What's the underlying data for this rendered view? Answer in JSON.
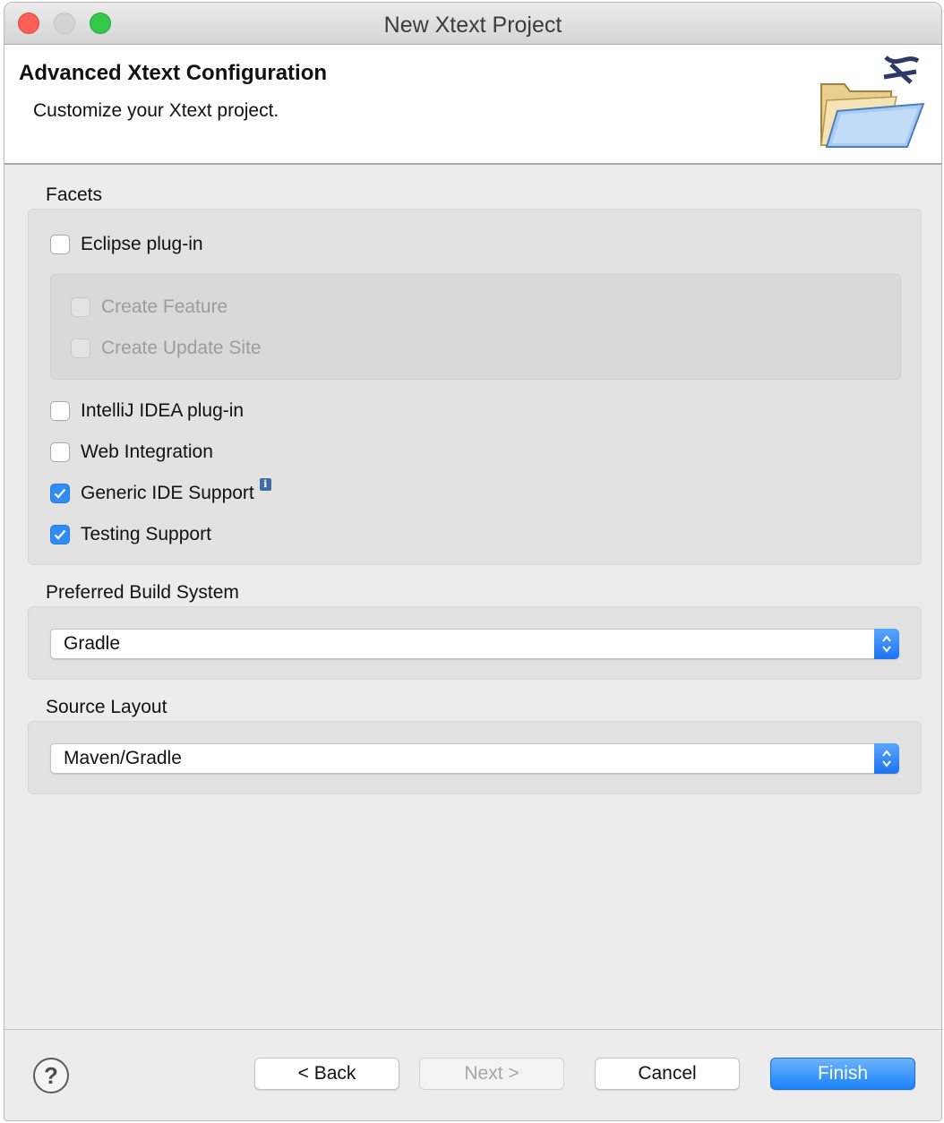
{
  "window": {
    "title": "New Xtext Project"
  },
  "banner": {
    "title": "Advanced Xtext Configuration",
    "description": "Customize your Xtext project.",
    "icon": "xtext-folder-icon"
  },
  "facets": {
    "label": "Facets",
    "eclipse_plugin": {
      "label": "Eclipse plug-in",
      "checked": false
    },
    "eclipse_sub": [
      {
        "label": "Create Feature",
        "checked": false,
        "enabled": false
      },
      {
        "label": "Create Update Site",
        "checked": false,
        "enabled": false
      }
    ],
    "items": [
      {
        "label": "IntelliJ IDEA plug-in",
        "checked": false
      },
      {
        "label": "Web Integration",
        "checked": false
      },
      {
        "label": "Generic IDE Support",
        "checked": true,
        "info": "i"
      },
      {
        "label": "Testing Support",
        "checked": true
      }
    ]
  },
  "build_system": {
    "label": "Preferred Build System",
    "value": "Gradle"
  },
  "source_layout": {
    "label": "Source Layout",
    "value": "Maven/Gradle"
  },
  "buttons": {
    "help": "?",
    "back": "< Back",
    "next": "Next >",
    "cancel": "Cancel",
    "finish": "Finish"
  },
  "colors": {
    "accent": "#2f8cf4",
    "primary_button": "#1a82fb",
    "close": "#fc5f57",
    "zoom": "#34c84a"
  }
}
